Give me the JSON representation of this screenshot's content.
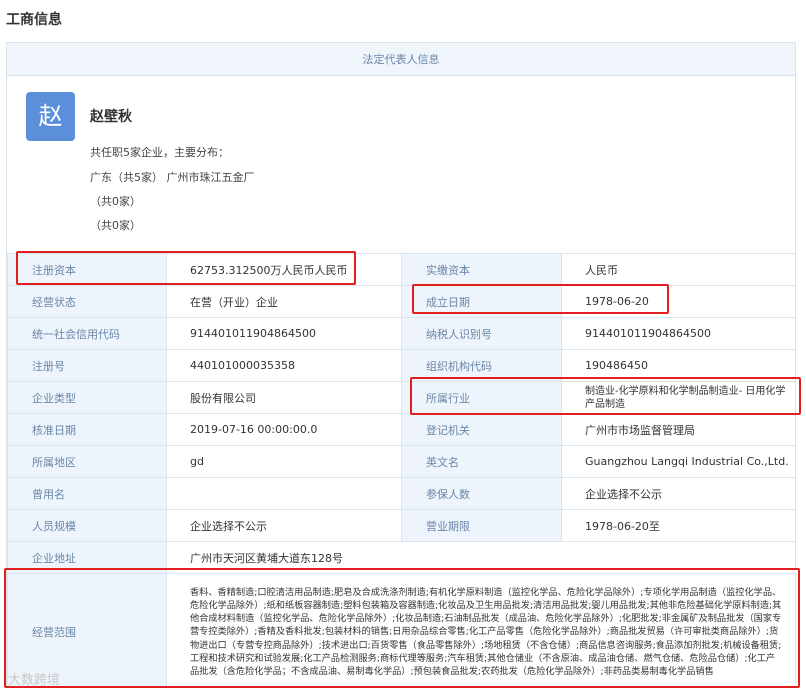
{
  "page": {
    "title": "工商信息"
  },
  "legal_section": {
    "header": "法定代表人信息",
    "avatar_char": "赵",
    "name": "赵壁秋",
    "summary": "共任职5家企业，主要分布：",
    "lines": [
      "广东（共5家） 广州市珠江五金厂",
      "（共0家）",
      "（共0家）"
    ]
  },
  "info": {
    "reg_capital": {
      "label": "注册资本",
      "value": "62753.312500万人民币人民币"
    },
    "paid_capital": {
      "label": "实缴资本",
      "value": "人民币"
    },
    "status": {
      "label": "经营状态",
      "value": "在营（开业）企业"
    },
    "found_date": {
      "label": "成立日期",
      "value": "1978-06-20"
    },
    "credit_code": {
      "label": "统一社会信用代码",
      "value": "914401011904864500"
    },
    "taxpayer_id": {
      "label": "纳税人识别号",
      "value": "914401011904864500"
    },
    "reg_no": {
      "label": "注册号",
      "value": "440101000035358"
    },
    "org_code": {
      "label": "组织机构代码",
      "value": "190486450"
    },
    "company_type": {
      "label": "企业类型",
      "value": "股份有限公司"
    },
    "industry": {
      "label": "所属行业",
      "value": "制造业-化学原料和化学制品制造业- 日用化学产品制造"
    },
    "approve_date": {
      "label": "核准日期",
      "value": "2019-07-16 00:00:00.0"
    },
    "authority": {
      "label": "登记机关",
      "value": "广州市市场监督管理局"
    },
    "region": {
      "label": "所属地区",
      "value": "gd"
    },
    "english_name": {
      "label": "英文名",
      "value": "Guangzhou Langqi Industrial Co.,Ltd."
    },
    "former_name": {
      "label": "曾用名",
      "value": ""
    },
    "insured": {
      "label": "参保人数",
      "value": "企业选择不公示"
    },
    "staff_size": {
      "label": "人员规模",
      "value": "企业选择不公示"
    },
    "term": {
      "label": "营业期限",
      "value": "1978-06-20至"
    },
    "address": {
      "label": "企业地址",
      "value": "广州市天河区黄埔大道东128号"
    },
    "scope": {
      "label": "经营范围",
      "value": "香料、香精制造;口腔清洁用品制造;肥皂及合成洗涤剂制造;有机化学原料制造（监控化学品、危险化学品除外）;专项化学用品制造（监控化学品、危险化学品除外）;纸和纸板容器制造;塑料包装箱及容器制造;化妆品及卫生用品批发;清洁用品批发;婴儿用品批发;其他非危险基础化学原料制造;其他合成材料制造（监控化学品、危险化学品除外）;化妆品制造;石油制品批发（成品油、危险化学品除外）;化肥批发;非金属矿及制品批发（国家专营专控类除外）;香精及香料批发;包装材料的销售;日用杂品综合零售;化工产品零售（危险化学品除外）;商品批发贸易（许可审批类商品除外）;货物进出口（专营专控商品除外）;技术进出口;百货零售（食品零售除外）;场地租赁（不含仓储）;商品信息咨询服务;食品添加剂批发;机械设备租赁;工程和技术研究和试验发展;化工产品检测服务;商标代理等服务;汽车租赁;其他仓储业（不含原油、成品油仓储、燃气仓储、危险品仓储）;化工产品批发（含危险化学品；不含成品油、易制毒化学品）;预包装食品批发;农药批发（危险化学品除外）;非药品类易制毒化学品销售"
    }
  },
  "watermark": "大数跨境",
  "colors": {
    "highlight": "#e02020",
    "avatar_bg": "#5b8fd9",
    "label_bg": "#eef4fb",
    "label_text": "#6a86a8"
  }
}
